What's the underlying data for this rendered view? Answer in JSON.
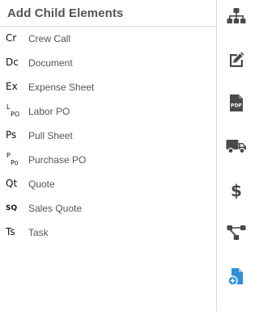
{
  "header": {
    "title": "Add Child Elements"
  },
  "items": [
    {
      "abbr": "Cr",
      "label": "Crew Call"
    },
    {
      "abbr": "Dc",
      "label": "Document"
    },
    {
      "abbr": "Ex",
      "label": "Expense Sheet"
    },
    {
      "abbr_sup": "L",
      "abbr_sub": "PO",
      "label": "Labor PO"
    },
    {
      "abbr": "Ps",
      "label": "Pull Sheet"
    },
    {
      "abbr_sup": "P",
      "abbr_sub": "Po",
      "label": "Purchase PO"
    },
    {
      "abbr": "Qt",
      "label": "Quote"
    },
    {
      "abbr_small": "SQ",
      "label": "Sales Quote"
    },
    {
      "abbr": "Ts",
      "label": "Task"
    }
  ],
  "sidebar": {
    "icons": [
      {
        "name": "org-chart-icon"
      },
      {
        "name": "edit-icon"
      },
      {
        "name": "pdf-file-icon",
        "text": "PDF"
      },
      {
        "name": "truck-icon"
      },
      {
        "name": "dollar-icon",
        "text": "$"
      },
      {
        "name": "network-icon"
      },
      {
        "name": "add-file-icon"
      }
    ],
    "icon_color": "#4a4a4a",
    "accent_color": "#2f8fd8"
  }
}
